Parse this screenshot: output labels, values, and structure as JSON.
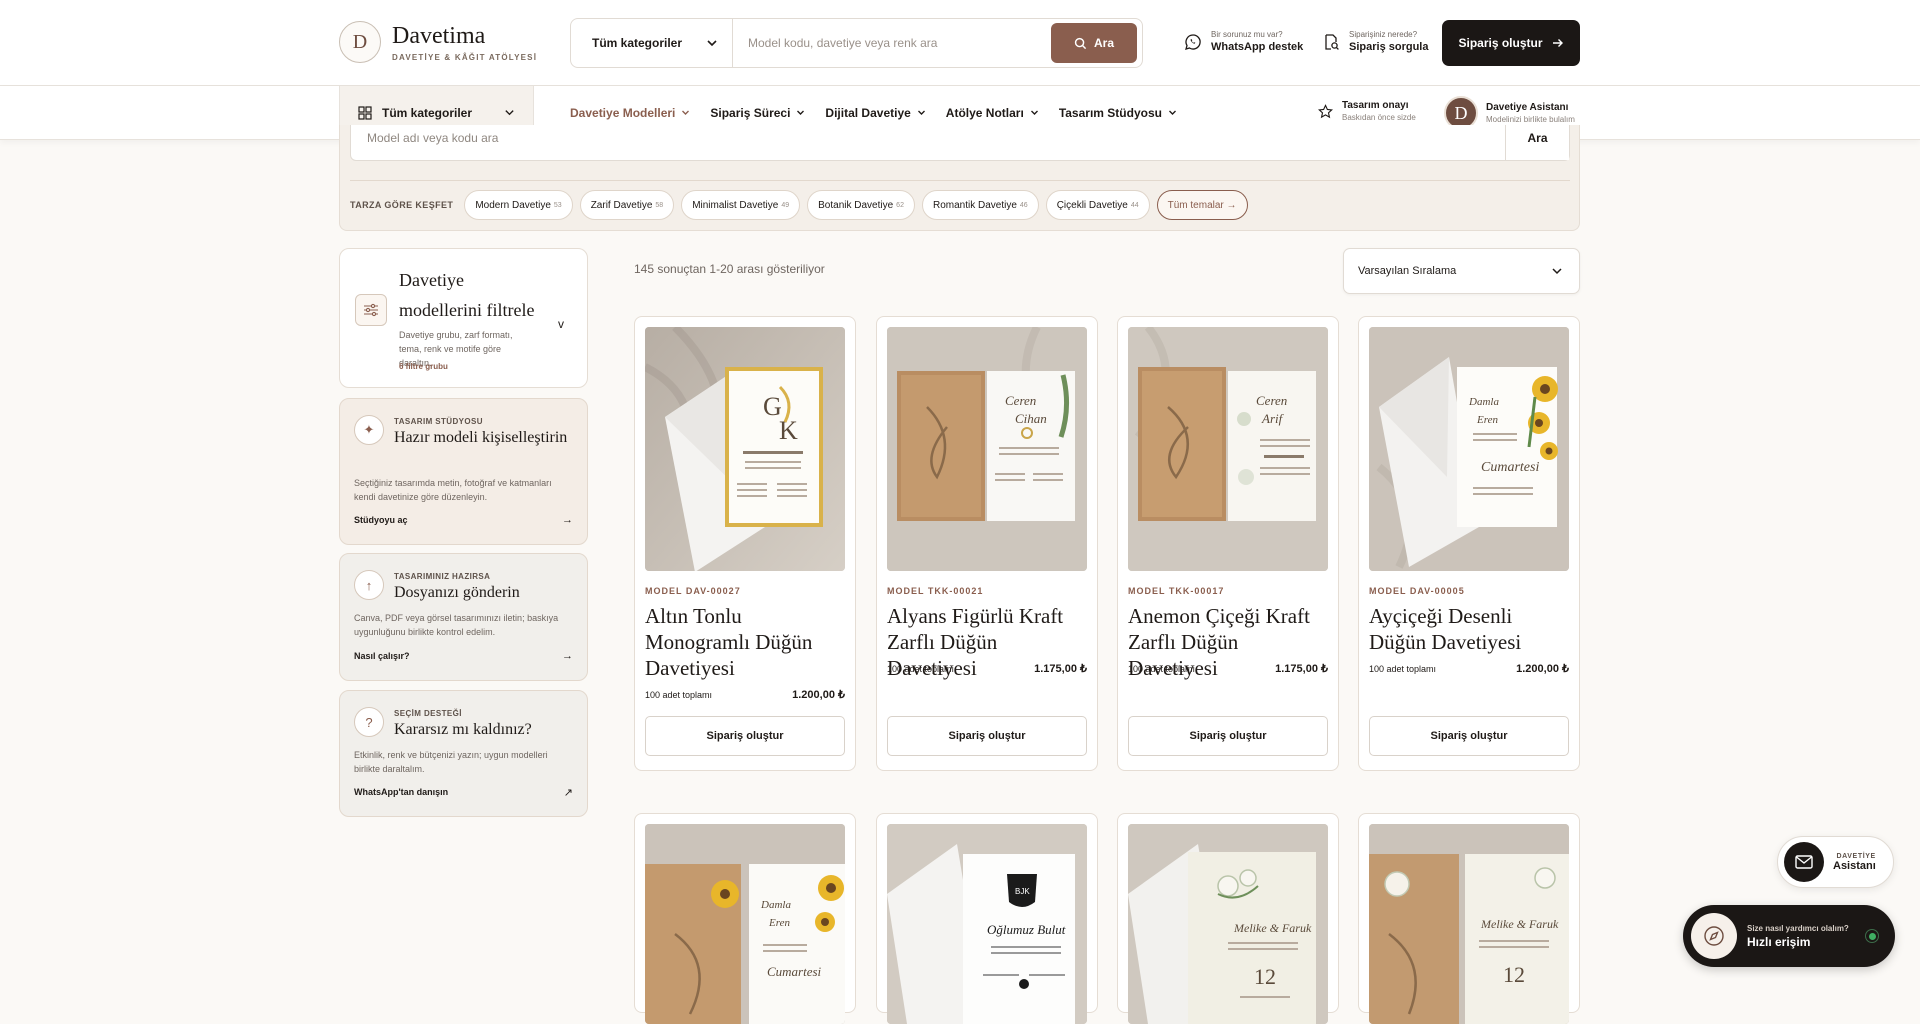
{
  "brand": {
    "initial": "D",
    "name": "Davetima",
    "tagline": "DAVETİYE & KÂĞIT ATÖLYESİ"
  },
  "search": {
    "category": "Tüm kategoriler",
    "placeholder": "Model kodu, davetiye veya renk ara",
    "button": "Ara"
  },
  "help": [
    {
      "small": "Bir sorunuz mu var?",
      "label": "WhatsApp destek",
      "icon": "whatsapp-icon"
    },
    {
      "small": "Siparişiniz nerede?",
      "label": "Sipariş sorgula",
      "icon": "order-search-icon"
    }
  ],
  "header_cta": "Sipariş oluştur",
  "nav": {
    "all_categories": "Tüm kategoriler",
    "items": [
      "Davetiye Modelleri",
      "Sipariş Süreci",
      "Dijital Davetiye",
      "Atölye Notları",
      "Tasarım Stüdyosu"
    ],
    "approval": {
      "title": "Tasarım onayı",
      "sub": "Baskıdan önce sizde"
    },
    "assistant": {
      "initial": "D",
      "title": "Davetiye Asistanı",
      "sub": "Modelinizi birlikte bulalım"
    }
  },
  "explore": {
    "placeholder": "Model adı veya kodu ara",
    "button": "Ara",
    "label": "TARZA GÖRE KEŞFET",
    "tags": [
      {
        "name": "Modern Davetiye",
        "count": "53"
      },
      {
        "name": "Zarif Davetiye",
        "count": "58"
      },
      {
        "name": "Minimalist Davetiye",
        "count": "49"
      },
      {
        "name": "Botanik Davetiye",
        "count": "62"
      },
      {
        "name": "Romantik Davetiye",
        "count": "46"
      },
      {
        "name": "Çiçekli Davetiye",
        "count": "44"
      }
    ],
    "all_tag": "Tüm temalar →"
  },
  "filter": {
    "title": "Davetiye modellerini filtrele",
    "desc": "Davetiye grubu, zarf formatı, tema, renk ve motife göre daraltın.",
    "count": "6 filtre grubu",
    "chevron": "v"
  },
  "side_cards": [
    {
      "kicker": "TASARIM STÜDYOSU",
      "title": "Hazır modeli kişiselleştirin",
      "desc": "Seçtiğiniz tasarımda metin, fotoğraf ve katmanları kendi davetinize göre düzenleyin.",
      "link": "Stüdyoyu aç",
      "arrow": "→",
      "icon": "✦"
    },
    {
      "kicker": "TASARIMINIZ HAZIRSA",
      "title": "Dosyanızı gönderin",
      "desc": "Canva, PDF veya görsel tasarımınızı iletin; baskıya uygunluğunu birlikte kontrol edelim.",
      "link": "Nasıl çalışır?",
      "arrow": "→",
      "icon": "↑"
    },
    {
      "kicker": "SEÇİM DESTEĞİ",
      "title": "Kararsız mı kaldınız?",
      "desc": "Etkinlik, renk ve bütçenizi yazın; uygun modelleri birlikte daraltalım.",
      "link": "WhatsApp'tan danışın",
      "arrow": "↗",
      "icon": "?"
    }
  ],
  "results": "145 sonuçtan 1-20 arası gösteriliyor",
  "sort": "Varsayılan Sıralama",
  "products": [
    {
      "model": "MODEL DAV-00027",
      "title": "Altın Tonlu Monogramlı Düğün Davetiyesi",
      "qty": "100 adet toplamı",
      "price": "1.200,00 ₺",
      "button": "Sipariş oluştur"
    },
    {
      "model": "MODEL TKK-00021",
      "title": "Alyans Figürlü Kraft Zarflı Düğün Davetiyesi",
      "qty": "100 adet toplamı",
      "price": "1.175,00 ₺",
      "button": "Sipariş oluştur"
    },
    {
      "model": "MODEL TKK-00017",
      "title": "Anemon Çiçeği Kraft Zarflı Düğün Davetiyesi",
      "qty": "100 adet toplamı",
      "price": "1.175,00 ₺",
      "button": "Sipariş oluştur"
    },
    {
      "model": "MODEL DAV-00005",
      "title": "Ayçiçeği Desenli Düğün Davetiyesi",
      "qty": "100 adet toplamı",
      "price": "1.200,00 ₺",
      "button": "Sipariş oluştur"
    }
  ],
  "float_assistant": {
    "small": "DAVETİYE",
    "label": "Asistanı"
  },
  "quick_access": {
    "small": "Size nasıl yardımcı olalım?",
    "label": "Hızlı erişim"
  },
  "colors": {
    "accent": "#8a5e4e",
    "dark": "#1b1715",
    "panel": "#f4efe9",
    "online": "#3fae62"
  }
}
